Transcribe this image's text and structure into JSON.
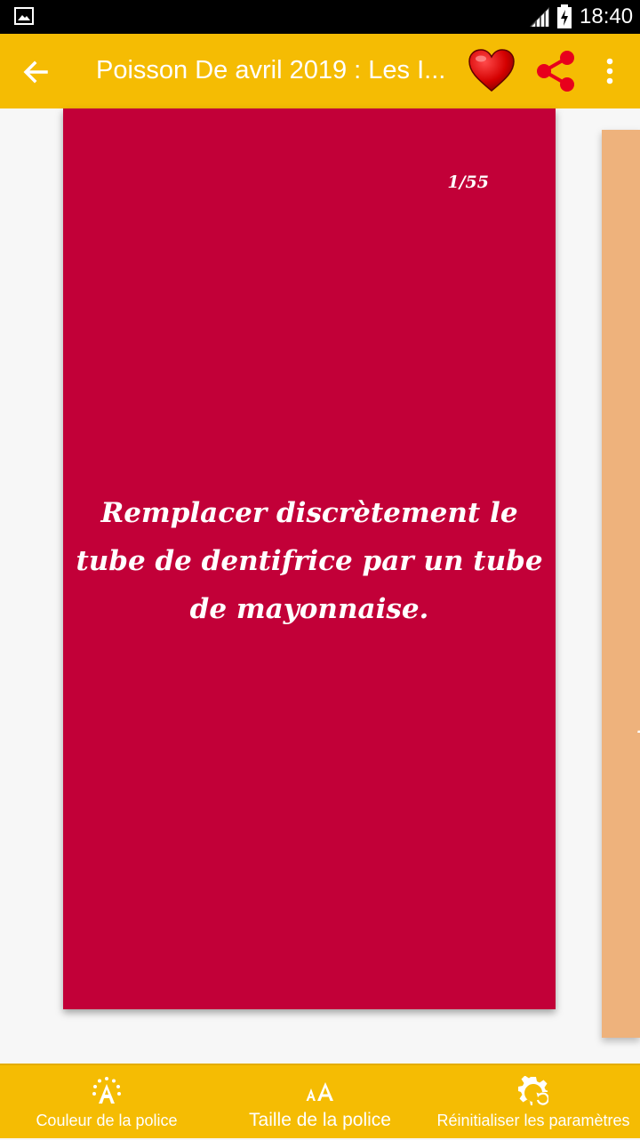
{
  "status_bar": {
    "time": "18:40",
    "icons": [
      "gallery-icon",
      "signal-icon",
      "battery-charging-icon"
    ]
  },
  "toolbar": {
    "title": "Poisson De avril 2019 : Les I...",
    "icons": [
      "back-arrow-icon",
      "heart-icon",
      "share-icon",
      "more-vertical-icon"
    ],
    "heart_color": "#d40000",
    "share_color": "#e8001c"
  },
  "card": {
    "counter": "1/55",
    "quote": "Remplacer discrètement le tube de dentifrice par un tube de mayonnaise.",
    "background": "#c20038"
  },
  "next_card": {
    "background": "#eeb27c",
    "peek_letter": "V"
  },
  "bottom_bar": {
    "items": [
      {
        "label": "Couleur de la police",
        "icon": "font-color-icon"
      },
      {
        "label": "Taille de la police",
        "icon": "font-size-icon"
      },
      {
        "label": "Réinitialiser les paramètres",
        "icon": "settings-reset-icon"
      }
    ]
  },
  "colors": {
    "accent": "#f5bc03",
    "background": "#f7f7f7"
  }
}
